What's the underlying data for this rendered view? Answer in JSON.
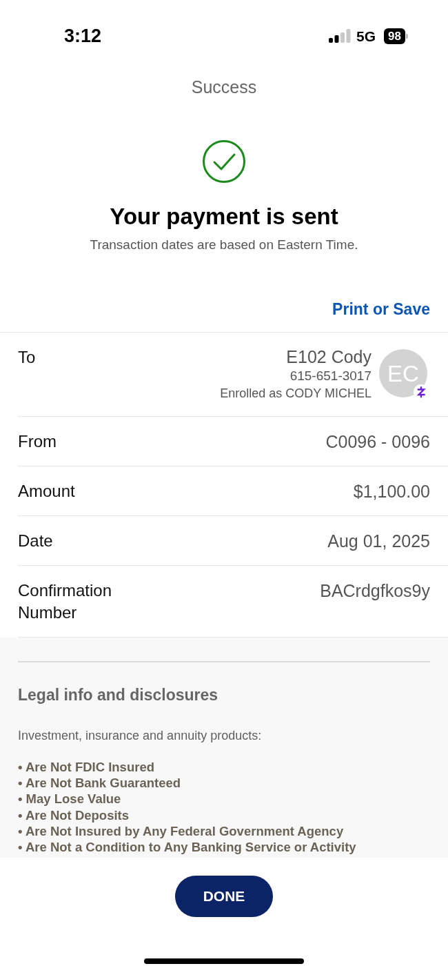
{
  "status_bar": {
    "time": "3:12",
    "network": "5G",
    "battery": "98"
  },
  "header": {
    "title": "Success"
  },
  "confirmation": {
    "heading": "Your payment is sent",
    "subtitle": "Transaction dates are based on Eastern Time.",
    "print_link": "Print or Save"
  },
  "details": [
    {
      "kind": "recipient",
      "label": "To",
      "name": "E102 Cody",
      "phone": "615-651-3017",
      "enrolled": "Enrolled as CODY MICHEL",
      "avatar_initials": "EC"
    },
    {
      "kind": "plain",
      "label": "From",
      "value": "C0096 - 0096"
    },
    {
      "kind": "plain",
      "label": "Amount",
      "value": "$1,100.00"
    },
    {
      "kind": "plain",
      "label": "Date",
      "value": "Aug 01, 2025"
    },
    {
      "kind": "plain",
      "label": "Confirmation Number",
      "value": "BACrdgfkos9y"
    }
  ],
  "legal": {
    "title": "Legal info and disclosures",
    "intro": "Investment, insurance and annuity products:",
    "items": [
      "• Are Not FDIC Insured",
      "• Are Not Bank Guaranteed",
      "• May Lose Value",
      "• Are Not Deposits",
      "• Are Not Insured by Any Federal Government Agency",
      "• Are Not a Condition to Any Banking Service or Activity"
    ]
  },
  "actions": {
    "done": "DONE"
  }
}
